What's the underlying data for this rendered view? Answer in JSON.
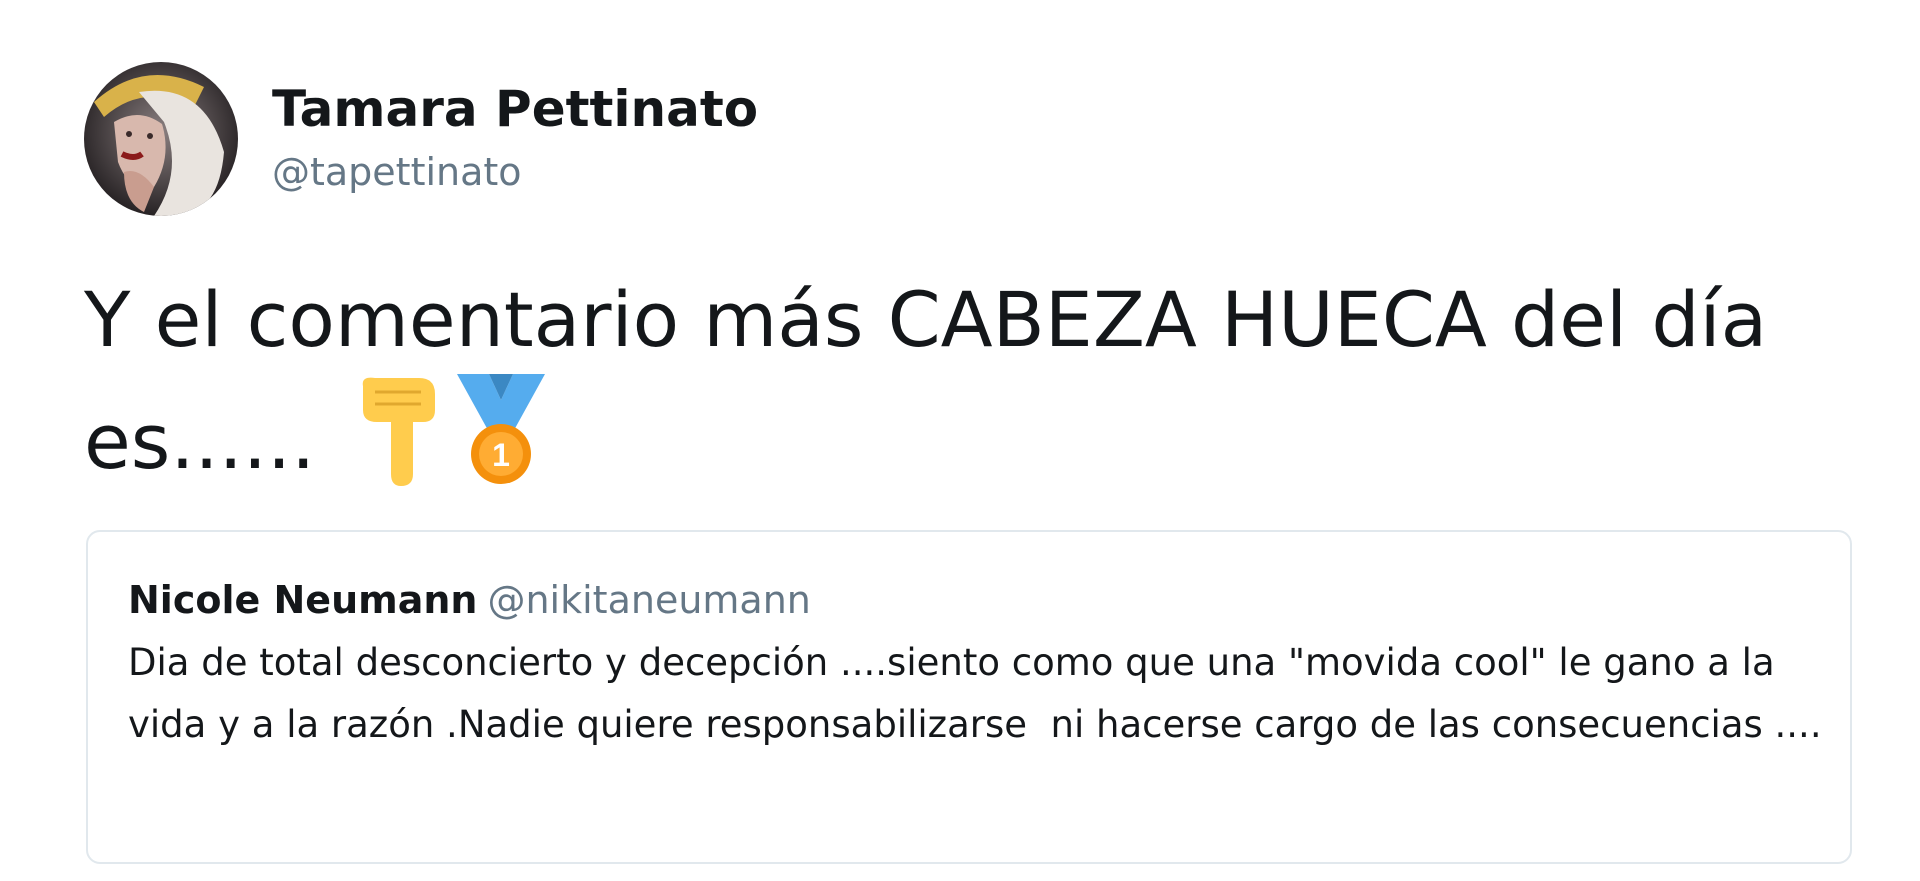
{
  "tweet": {
    "author_name": "Tamara Pettinato",
    "author_handle": "@tapettinato",
    "text_line1": "Y el comentario más CABEZA HUECA del día",
    "text_line2": "es......",
    "emojis": [
      "backhand-index-pointing-down",
      "1st-place-medal"
    ]
  },
  "quoted_tweet": {
    "author_name": "Nicole Neumann",
    "author_handle": "@nikitaneumann",
    "text": "Dia de total desconcierto y decepción ....siento como que una \"movida cool\" le gano a la vida y a la razón .Nadie quiere responsabilizarse  ni hacerse cargo de las consecuencias ...."
  },
  "colors": {
    "text": "#14171a",
    "secondary": "#657786",
    "border": "#e1e8ed",
    "emoji_yellow": "#ffcc4d",
    "medal_blue": "#55acee",
    "medal_orange": "#f4900c"
  }
}
